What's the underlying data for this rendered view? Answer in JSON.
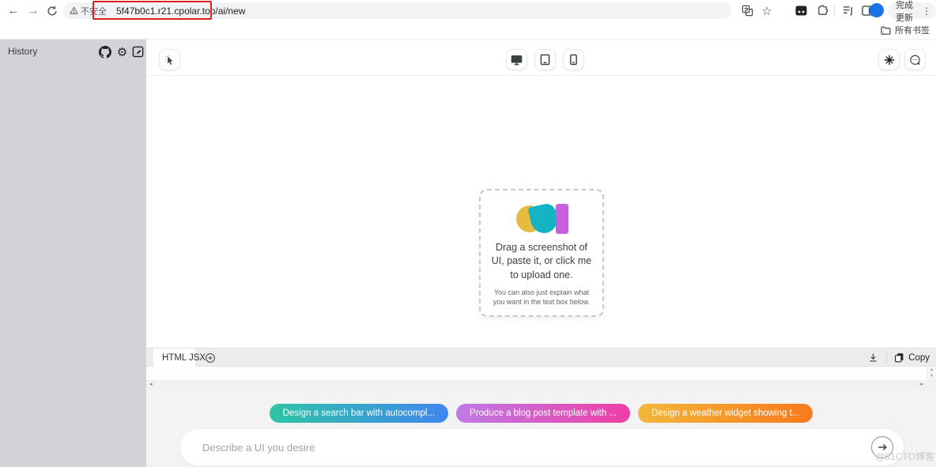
{
  "browser": {
    "security_label": "不安全",
    "url": "5f47b0c1.r21.cpolar.top/ai/new",
    "update_label": "完成更新",
    "bookmarks_label": "所有书签"
  },
  "sidebar": {
    "title": "History"
  },
  "upload_card": {
    "title": "Drag a screenshot of UI, paste it, or click me to upload one.",
    "subtitle": "You can also just explain what you want in the text box below."
  },
  "code_panel": {
    "tabs": [
      "HTML",
      "JSX"
    ],
    "copy_label": "Copy"
  },
  "suggestions": [
    {
      "label": "Design a search bar with autocompl...",
      "gradient_from": "#2ec4a5",
      "gradient_to": "#4186f0"
    },
    {
      "label": "Produce a blog post template with ...",
      "gradient_from": "#bf7ae6",
      "gradient_to": "#ee3fa4"
    },
    {
      "label": "Design a weather widget showing t...",
      "gradient_from": "#f2b73a",
      "gradient_to": "#f9791d"
    }
  ],
  "prompt": {
    "placeholder": "Describe a UI you desire"
  },
  "watermark": "@51CTO博客",
  "colors": {
    "sidebar_bg": "#d3d3d7",
    "annotation_red": "#e02020",
    "logo_yellow": "#e6bc3e",
    "logo_teal": "#14b4c6",
    "logo_magenta": "#c95fe0",
    "avatar_blue": "#1a73e8"
  }
}
